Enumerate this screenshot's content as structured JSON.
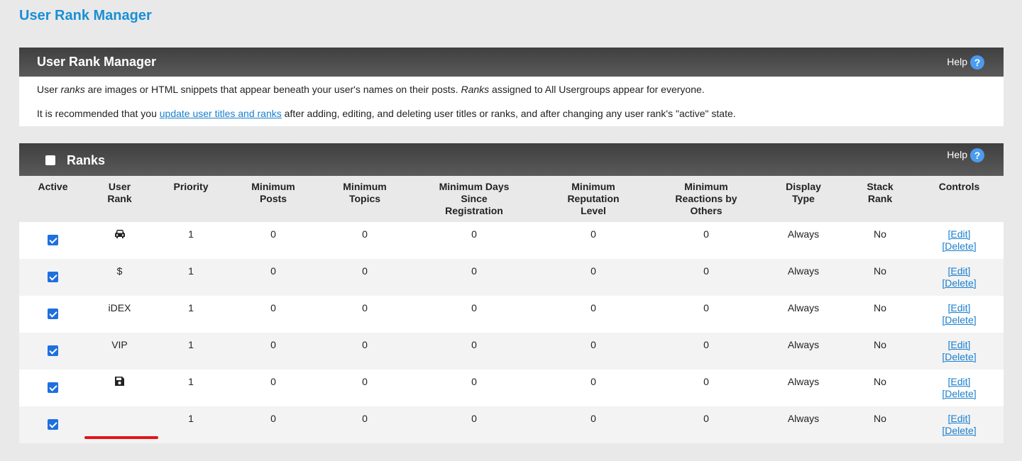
{
  "page_title": "User Rank Manager",
  "info_panel": {
    "title": "User Rank Manager",
    "help_label": "Help",
    "line1_part1": "User ",
    "line1_em1": "ranks",
    "line1_part2": " are images or HTML snippets that appear beneath your user's names on their posts. ",
    "line1_em2": "Ranks",
    "line1_part3": " assigned to All Usergroups appear for everyone.",
    "line2_part1": "It is recommended that you ",
    "line2_link": "update user titles and ranks",
    "line2_part2": " after adding, editing, and deleting user titles or ranks, and after changing any user rank's \"active\" state."
  },
  "ranks_panel": {
    "title": "Ranks",
    "help_label": "Help",
    "columns": [
      "Active",
      "User Rank",
      "Priority",
      "Minimum Posts",
      "Minimum Topics",
      "Minimum Days Since Registration",
      "Minimum Reputation Level",
      "Minimum Reactions by Others",
      "Display Type",
      "Stack Rank",
      "Controls"
    ],
    "edit_label": "[Edit]",
    "delete_label": "[Delete]",
    "rows": [
      {
        "active": true,
        "rank_icon": "car-icon",
        "rank_text": "",
        "priority": "1",
        "min_posts": "0",
        "min_topics": "0",
        "min_days": "0",
        "min_rep": "0",
        "min_reactions": "0",
        "display_type": "Always",
        "stack_rank": "No"
      },
      {
        "active": true,
        "rank_icon": "",
        "rank_text": "$",
        "priority": "1",
        "min_posts": "0",
        "min_topics": "0",
        "min_days": "0",
        "min_rep": "0",
        "min_reactions": "0",
        "display_type": "Always",
        "stack_rank": "No"
      },
      {
        "active": true,
        "rank_icon": "",
        "rank_text": "iDEX",
        "priority": "1",
        "min_posts": "0",
        "min_topics": "0",
        "min_days": "0",
        "min_rep": "0",
        "min_reactions": "0",
        "display_type": "Always",
        "stack_rank": "No"
      },
      {
        "active": true,
        "rank_icon": "",
        "rank_text": "VIP",
        "priority": "1",
        "min_posts": "0",
        "min_topics": "0",
        "min_days": "0",
        "min_rep": "0",
        "min_reactions": "0",
        "display_type": "Always",
        "stack_rank": "No"
      },
      {
        "active": true,
        "rank_icon": "floppy-disk-icon",
        "rank_text": "",
        "priority": "1",
        "min_posts": "0",
        "min_topics": "0",
        "min_days": "0",
        "min_rep": "0",
        "min_reactions": "0",
        "display_type": "Always",
        "stack_rank": "No"
      },
      {
        "active": true,
        "rank_icon": "",
        "rank_text": "",
        "priority": "1",
        "min_posts": "0",
        "min_topics": "0",
        "min_days": "0",
        "min_rep": "0",
        "min_reactions": "0",
        "display_type": "Always",
        "stack_rank": "No"
      }
    ]
  },
  "colors": {
    "accent": "#1a8fd6",
    "header_bg": "#4a4a4a",
    "checkbox": "#1f6fde",
    "annotation_underline": "#e3141b"
  }
}
